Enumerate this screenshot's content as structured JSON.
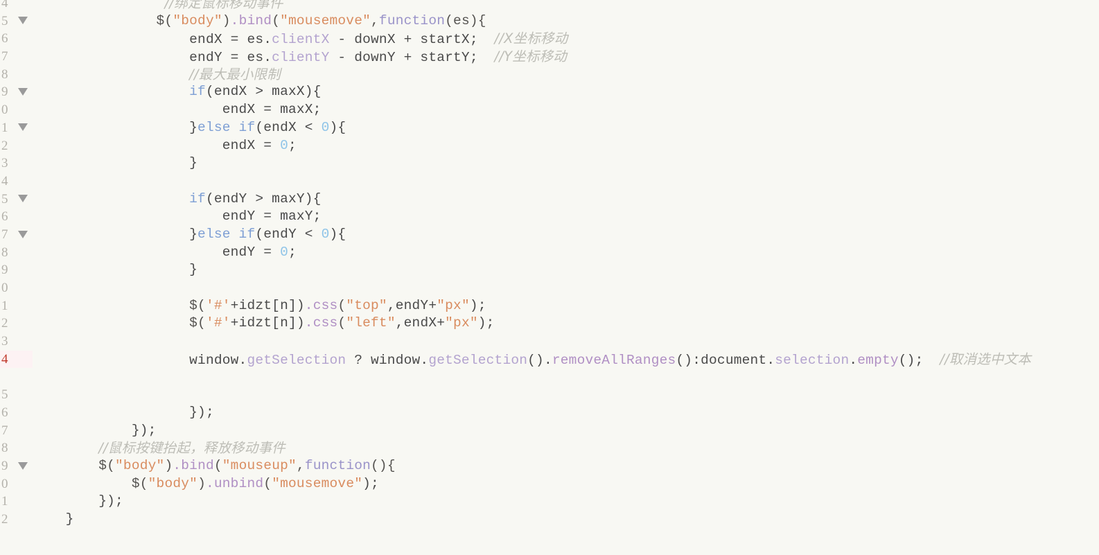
{
  "editor": {
    "background_color": "#f8f8f3",
    "gutter_text_color": "#b4b2ab",
    "active_line_number_color": "#c0392b",
    "active_line_background": "#fdf2f3",
    "active_line_number": "4",
    "colors": {
      "plain": "#4a4a4a",
      "string": "#d98c5f",
      "comment": "#bdbdb6",
      "keyword": "#7e9fd4",
      "number": "#8fc4e8",
      "method": "#b08fc4",
      "property": "#b3a3cf"
    }
  },
  "lines": [
    {
      "number": "4",
      "fold": false,
      "active": false,
      "tokens": [
        {
          "text": "                ",
          "type": "plain"
        },
        {
          "text": "//绑定鼠标移动事件",
          "type": "comment"
        }
      ]
    },
    {
      "number": "5",
      "fold": true,
      "active": false,
      "tokens": [
        {
          "text": "               ",
          "type": "plain"
        },
        {
          "text": "$(",
          "type": "punc"
        },
        {
          "text": "\"body\"",
          "type": "string"
        },
        {
          "text": ")",
          "type": "punc"
        },
        {
          "text": ".bind",
          "type": "method"
        },
        {
          "text": "(",
          "type": "punc"
        },
        {
          "text": "\"mousemove\"",
          "type": "string"
        },
        {
          "text": ",",
          "type": "punc"
        },
        {
          "text": "function",
          "type": "fn"
        },
        {
          "text": "(es){",
          "type": "punc"
        }
      ]
    },
    {
      "number": "6",
      "fold": false,
      "active": false,
      "tokens": [
        {
          "text": "                   ",
          "type": "plain"
        },
        {
          "text": "endX = es.",
          "type": "plain"
        },
        {
          "text": "clientX",
          "type": "property"
        },
        {
          "text": " - downX + startX;  ",
          "type": "plain"
        },
        {
          "text": "//X坐标移动",
          "type": "comment"
        }
      ]
    },
    {
      "number": "7",
      "fold": false,
      "active": false,
      "tokens": [
        {
          "text": "                   ",
          "type": "plain"
        },
        {
          "text": "endY = es.",
          "type": "plain"
        },
        {
          "text": "clientY",
          "type": "property"
        },
        {
          "text": " - downY + startY;  ",
          "type": "plain"
        },
        {
          "text": "//Y坐标移动",
          "type": "comment"
        }
      ]
    },
    {
      "number": "8",
      "fold": false,
      "active": false,
      "tokens": [
        {
          "text": "                   ",
          "type": "plain"
        },
        {
          "text": "//最大最小限制",
          "type": "comment"
        }
      ]
    },
    {
      "number": "9",
      "fold": true,
      "active": false,
      "tokens": [
        {
          "text": "                   ",
          "type": "plain"
        },
        {
          "text": "if",
          "type": "keyword"
        },
        {
          "text": "(endX > maxX){",
          "type": "plain"
        }
      ]
    },
    {
      "number": "0",
      "fold": false,
      "active": false,
      "tokens": [
        {
          "text": "                       ",
          "type": "plain"
        },
        {
          "text": "endX = maxX;",
          "type": "plain"
        }
      ]
    },
    {
      "number": "1",
      "fold": true,
      "active": false,
      "tokens": [
        {
          "text": "                   ",
          "type": "plain"
        },
        {
          "text": "}",
          "type": "plain"
        },
        {
          "text": "else if",
          "type": "keyword"
        },
        {
          "text": "(endX < ",
          "type": "plain"
        },
        {
          "text": "0",
          "type": "number"
        },
        {
          "text": "){",
          "type": "plain"
        }
      ]
    },
    {
      "number": "2",
      "fold": false,
      "active": false,
      "tokens": [
        {
          "text": "                       ",
          "type": "plain"
        },
        {
          "text": "endX = ",
          "type": "plain"
        },
        {
          "text": "0",
          "type": "number"
        },
        {
          "text": ";",
          "type": "plain"
        }
      ]
    },
    {
      "number": "3",
      "fold": false,
      "active": false,
      "tokens": [
        {
          "text": "                   ",
          "type": "plain"
        },
        {
          "text": "}",
          "type": "plain"
        }
      ]
    },
    {
      "number": "4",
      "fold": false,
      "active": false,
      "tokens": []
    },
    {
      "number": "5",
      "fold": true,
      "active": false,
      "tokens": [
        {
          "text": "                   ",
          "type": "plain"
        },
        {
          "text": "if",
          "type": "keyword"
        },
        {
          "text": "(endY > maxY){",
          "type": "plain"
        }
      ]
    },
    {
      "number": "6",
      "fold": false,
      "active": false,
      "tokens": [
        {
          "text": "                       ",
          "type": "plain"
        },
        {
          "text": "endY = maxY;",
          "type": "plain"
        }
      ]
    },
    {
      "number": "7",
      "fold": true,
      "active": false,
      "tokens": [
        {
          "text": "                   ",
          "type": "plain"
        },
        {
          "text": "}",
          "type": "plain"
        },
        {
          "text": "else if",
          "type": "keyword"
        },
        {
          "text": "(endY < ",
          "type": "plain"
        },
        {
          "text": "0",
          "type": "number"
        },
        {
          "text": "){",
          "type": "plain"
        }
      ]
    },
    {
      "number": "8",
      "fold": false,
      "active": false,
      "tokens": [
        {
          "text": "                       ",
          "type": "plain"
        },
        {
          "text": "endY = ",
          "type": "plain"
        },
        {
          "text": "0",
          "type": "number"
        },
        {
          "text": ";",
          "type": "plain"
        }
      ]
    },
    {
      "number": "9",
      "fold": false,
      "active": false,
      "tokens": [
        {
          "text": "                   ",
          "type": "plain"
        },
        {
          "text": "}",
          "type": "plain"
        }
      ]
    },
    {
      "number": "0",
      "fold": false,
      "active": false,
      "tokens": []
    },
    {
      "number": "1",
      "fold": false,
      "active": false,
      "tokens": [
        {
          "text": "                   ",
          "type": "plain"
        },
        {
          "text": "$(",
          "type": "punc"
        },
        {
          "text": "'#'",
          "type": "string"
        },
        {
          "text": "+idzt[n])",
          "type": "plain"
        },
        {
          "text": ".css",
          "type": "method"
        },
        {
          "text": "(",
          "type": "punc"
        },
        {
          "text": "\"top\"",
          "type": "string"
        },
        {
          "text": ",endY+",
          "type": "plain"
        },
        {
          "text": "\"px\"",
          "type": "string"
        },
        {
          "text": ");",
          "type": "plain"
        }
      ]
    },
    {
      "number": "2",
      "fold": false,
      "active": false,
      "tokens": [
        {
          "text": "                   ",
          "type": "plain"
        },
        {
          "text": "$(",
          "type": "punc"
        },
        {
          "text": "'#'",
          "type": "string"
        },
        {
          "text": "+idzt[n])",
          "type": "plain"
        },
        {
          "text": ".css",
          "type": "method"
        },
        {
          "text": "(",
          "type": "punc"
        },
        {
          "text": "\"left\"",
          "type": "string"
        },
        {
          "text": ",endX+",
          "type": "plain"
        },
        {
          "text": "\"px\"",
          "type": "string"
        },
        {
          "text": ");",
          "type": "plain"
        }
      ]
    },
    {
      "number": "3",
      "fold": false,
      "active": false,
      "tokens": []
    },
    {
      "number": "4",
      "fold": false,
      "active": true,
      "wrapped": true,
      "tokens": [
        {
          "text": "                   ",
          "type": "plain"
        },
        {
          "text": "window.",
          "type": "plain"
        },
        {
          "text": "getSelection",
          "type": "property"
        },
        {
          "text": " ? window.",
          "type": "plain"
        },
        {
          "text": "getSelection",
          "type": "property"
        },
        {
          "text": "().",
          "type": "plain"
        },
        {
          "text": "removeAllRanges",
          "type": "method"
        },
        {
          "text": "():document.",
          "type": "plain"
        },
        {
          "text": "selection",
          "type": "property"
        },
        {
          "text": ".",
          "type": "plain"
        },
        {
          "text": "empty",
          "type": "method"
        },
        {
          "text": "();  ",
          "type": "plain"
        },
        {
          "text": "//取消选中文本",
          "type": "comment"
        }
      ]
    },
    {
      "number": "5",
      "fold": false,
      "active": false,
      "tokens": []
    },
    {
      "number": "6",
      "fold": false,
      "active": false,
      "tokens": [
        {
          "text": "                   ",
          "type": "plain"
        },
        {
          "text": "});",
          "type": "plain"
        }
      ]
    },
    {
      "number": "7",
      "fold": false,
      "active": false,
      "tokens": [
        {
          "text": "            ",
          "type": "plain"
        },
        {
          "text": "});",
          "type": "plain"
        }
      ]
    },
    {
      "number": "8",
      "fold": false,
      "active": false,
      "tokens": [
        {
          "text": "        ",
          "type": "plain"
        },
        {
          "text": "//鼠标按键抬起，释放移动事件",
          "type": "comment"
        }
      ]
    },
    {
      "number": "9",
      "fold": true,
      "active": false,
      "tokens": [
        {
          "text": "        ",
          "type": "plain"
        },
        {
          "text": "$(",
          "type": "punc"
        },
        {
          "text": "\"body\"",
          "type": "string"
        },
        {
          "text": ")",
          "type": "punc"
        },
        {
          "text": ".bind",
          "type": "method"
        },
        {
          "text": "(",
          "type": "punc"
        },
        {
          "text": "\"mouseup\"",
          "type": "string"
        },
        {
          "text": ",",
          "type": "punc"
        },
        {
          "text": "function",
          "type": "fn"
        },
        {
          "text": "(){",
          "type": "punc"
        }
      ]
    },
    {
      "number": "0",
      "fold": false,
      "active": false,
      "tokens": [
        {
          "text": "            ",
          "type": "plain"
        },
        {
          "text": "$(",
          "type": "punc"
        },
        {
          "text": "\"body\"",
          "type": "string"
        },
        {
          "text": ")",
          "type": "punc"
        },
        {
          "text": ".unbind",
          "type": "method"
        },
        {
          "text": "(",
          "type": "punc"
        },
        {
          "text": "\"mousemove\"",
          "type": "string"
        },
        {
          "text": ");",
          "type": "plain"
        }
      ]
    },
    {
      "number": "1",
      "fold": false,
      "active": false,
      "tokens": [
        {
          "text": "        ",
          "type": "plain"
        },
        {
          "text": "});",
          "type": "plain"
        }
      ]
    },
    {
      "number": "2",
      "fold": false,
      "active": false,
      "tokens": [
        {
          "text": "    ",
          "type": "plain"
        },
        {
          "text": "}",
          "type": "plain"
        }
      ]
    }
  ]
}
